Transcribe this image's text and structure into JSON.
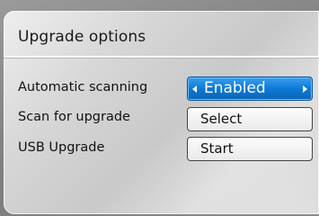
{
  "dialog": {
    "title": "Upgrade options"
  },
  "options": [
    {
      "label": "Automatic scanning",
      "value": "Enabled"
    },
    {
      "label": "Scan for upgrade",
      "value": "Select"
    },
    {
      "label": "USB Upgrade",
      "value": "Start"
    }
  ],
  "colors": {
    "highlight": "#0d7ad6"
  },
  "icons": {
    "left": "arrow-left-icon",
    "right": "arrow-right-icon"
  }
}
